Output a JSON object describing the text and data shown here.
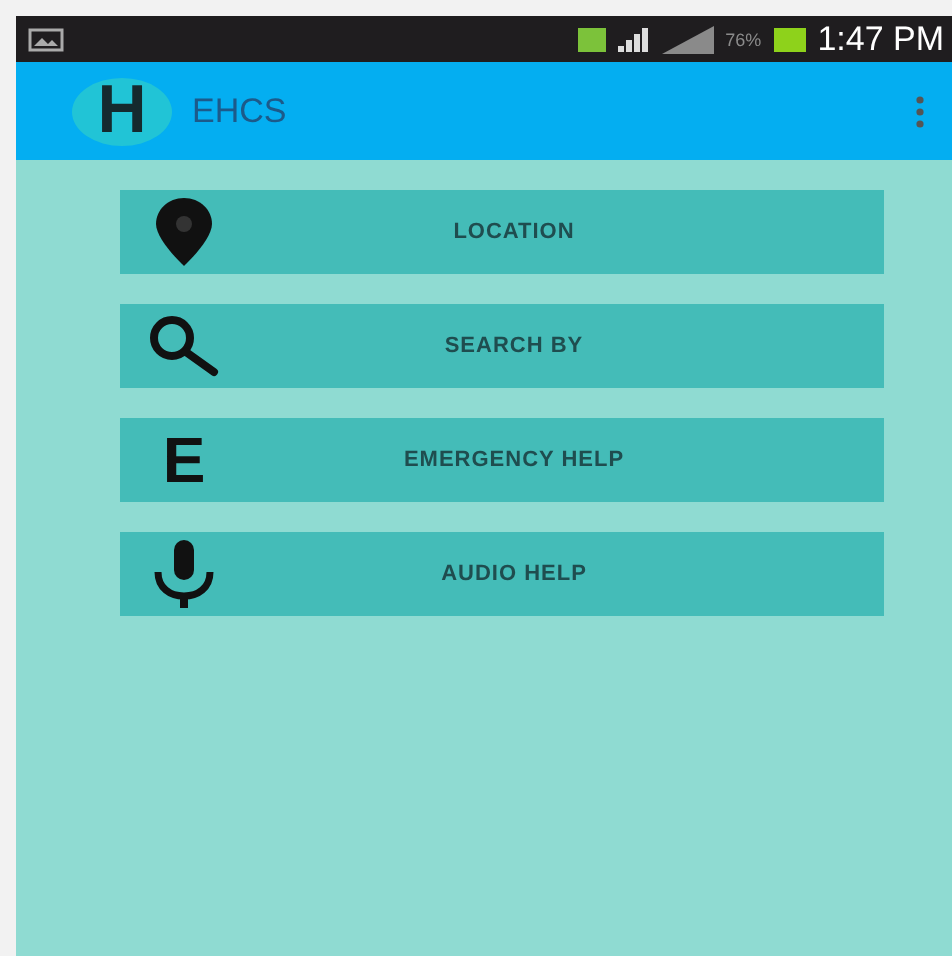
{
  "status_bar": {
    "battery_percent": "76%",
    "time": "1:47 PM"
  },
  "app_bar": {
    "title": "EHCS",
    "logo_letter": "H"
  },
  "buttons": [
    {
      "kind": "pin",
      "label": "LOCATION"
    },
    {
      "kind": "search",
      "label": "SEARCH BY"
    },
    {
      "kind": "letter",
      "letter": "E",
      "label": "EMERGENCY HELP"
    },
    {
      "kind": "mic",
      "label": "AUDIO HELP"
    }
  ]
}
